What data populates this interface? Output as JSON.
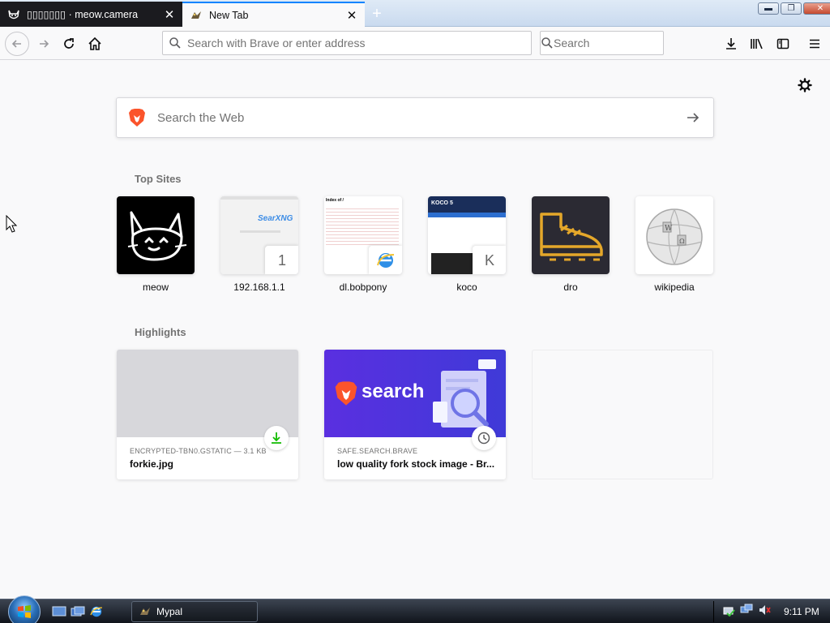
{
  "tabs": [
    {
      "title": "▯▯▯▯▯▯▯ · meow.camera",
      "active": false
    },
    {
      "title": "New Tab",
      "active": true
    }
  ],
  "window_controls": {
    "minimize": "▬",
    "maximize": "❐",
    "close": "✕"
  },
  "nav": {
    "url_placeholder": "Search with Brave or enter address",
    "search_placeholder": "Search"
  },
  "page": {
    "web_search_placeholder": "Search the Web",
    "top_sites_title": "Top Sites",
    "top_sites": [
      {
        "label": "meow"
      },
      {
        "label": "192.168.1.1",
        "badge": "1",
        "thumb_text": "SearXNG"
      },
      {
        "label": "dl.bobpony",
        "thumb_text": "Index of /"
      },
      {
        "label": "koco",
        "badge": "K",
        "thumb_text": "KOCO 5"
      },
      {
        "label": "dro"
      },
      {
        "label": "wikipedia"
      }
    ],
    "highlights_title": "Highlights",
    "highlights": [
      {
        "meta": "ENCRYPTED-TBN0.GSTATIC — 3.1 KB",
        "title": "forkie.jpg",
        "icon": "download-icon"
      },
      {
        "meta": "SAFE.SEARCH.BRAVE",
        "title": "low quality fork stock image - Br...",
        "icon": "clock-icon",
        "image_text": "search"
      }
    ]
  },
  "taskbar": {
    "task_label": "Mypal",
    "clock": "9:11 PM"
  },
  "colors": {
    "accent": "#0a84ff",
    "brave_orange": "#fb542b",
    "download_green": "#12bc00",
    "brave_search_purple": "#4537e8"
  }
}
